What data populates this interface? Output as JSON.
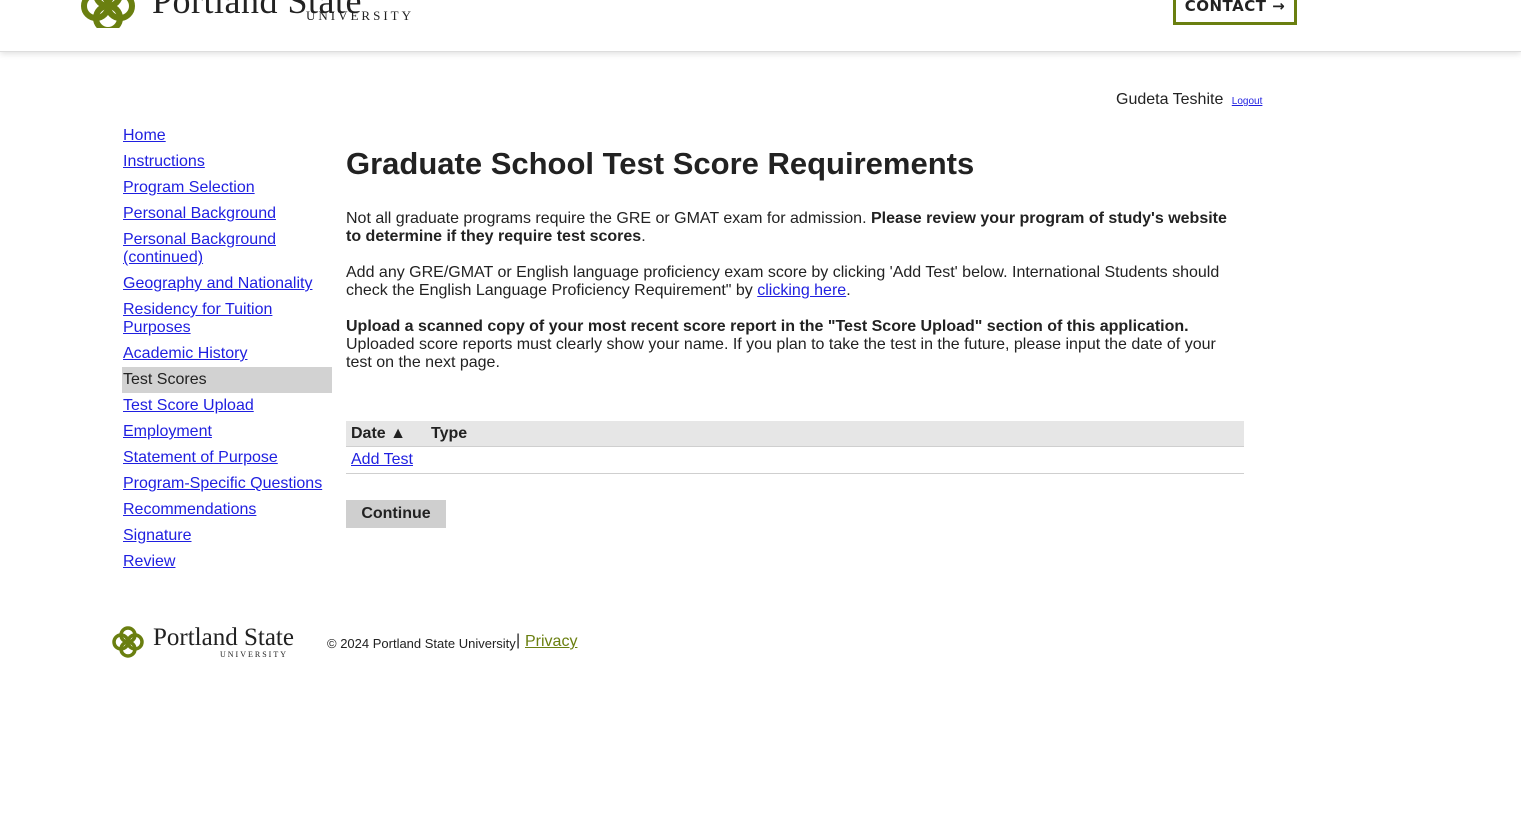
{
  "header": {
    "logo_wordmark": "Portland State",
    "logo_subtitle": "UNIVERSITY",
    "contact_label": "CONTACT →"
  },
  "user": {
    "name": "Gudeta Teshite",
    "logout_label": "Logout"
  },
  "sidebar": {
    "items": [
      {
        "label": "Home"
      },
      {
        "label": "Instructions"
      },
      {
        "label": "Program Selection"
      },
      {
        "label": "Personal Background"
      },
      {
        "label": "Personal Background (continued)"
      },
      {
        "label": "Geography and Nationality"
      },
      {
        "label": "Residency for Tuition Purposes"
      },
      {
        "label": "Academic History"
      },
      {
        "label": "Test Scores",
        "current": true
      },
      {
        "label": "Test Score Upload"
      },
      {
        "label": "Employment"
      },
      {
        "label": "Statement of Purpose"
      },
      {
        "label": "Program-Specific Questions"
      },
      {
        "label": "Recommendations"
      },
      {
        "label": "Signature"
      },
      {
        "label": "Review"
      }
    ]
  },
  "main": {
    "title": "Graduate School Test Score Requirements",
    "p1_text": "Not all graduate programs require the GRE or GMAT exam for admission. ",
    "p1_bold": "Please review your program of study's website to determine if they require test scores",
    "p1_end": ".",
    "p2_text": "Add any GRE/GMAT or English language proficiency exam score by clicking 'Add Test' below. International Students should check the English Language Proficiency Requirement\" by ",
    "p2_link": "clicking here",
    "p2_end": ".",
    "p3_bold": "Upload a scanned copy of your most recent score report in the \"Test Score Upload\" section of this application.",
    "p3_text": " Uploaded score reports must clearly show your name. If you plan to take the test in the future, please input the date of your test on the next page."
  },
  "table": {
    "col_date": "Date ▲",
    "col_type": "Type",
    "add_test_label": "Add Test"
  },
  "actions": {
    "continue_label": "Continue"
  },
  "footer": {
    "logo_wordmark": "Portland State",
    "logo_subtitle": "UNIVERSITY",
    "copyright": "© 2024 Portland State University",
    "separator": "|",
    "privacy_label": "Privacy"
  },
  "colors": {
    "brand_green": "#6a7f10",
    "link_blue": "#1f1fe0",
    "current_nav_bg": "#d2d2d2"
  }
}
